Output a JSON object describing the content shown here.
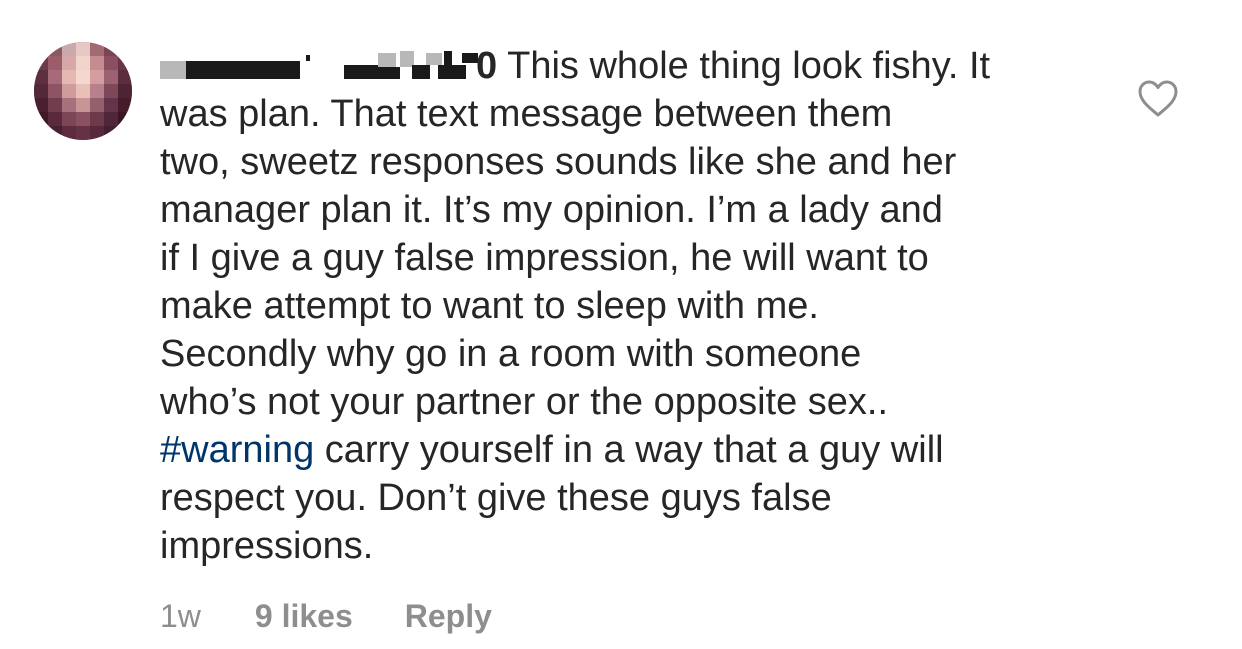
{
  "comment": {
    "username": "",
    "lines": [
      "This whole thing look fishy. It",
      "was plan. That text message between them",
      "two, sweetz responses sounds like she and her",
      "manager plan it. It’s my opinion. I’m a lady and",
      "if I give a guy false impression, he will want to",
      "make attempt to want to sleep with me.",
      "Secondly why go in a room with someone",
      "who’s not your partner or the opposite sex..",
      "carry yourself in a way that a guy will",
      "respect you. Don’t give these guys false",
      "impressions."
    ],
    "username_tail": "0",
    "hashtag": "#warning",
    "timestamp": "1w",
    "likes": "9 likes",
    "reply_label": "Reply"
  },
  "icons": {
    "like": "heart-outline-icon",
    "avatar": "blurred-avatar"
  },
  "colors": {
    "text": "#262626",
    "muted": "#8e8e8e",
    "hashtag": "#003569",
    "heart": "#8e8e8e"
  }
}
